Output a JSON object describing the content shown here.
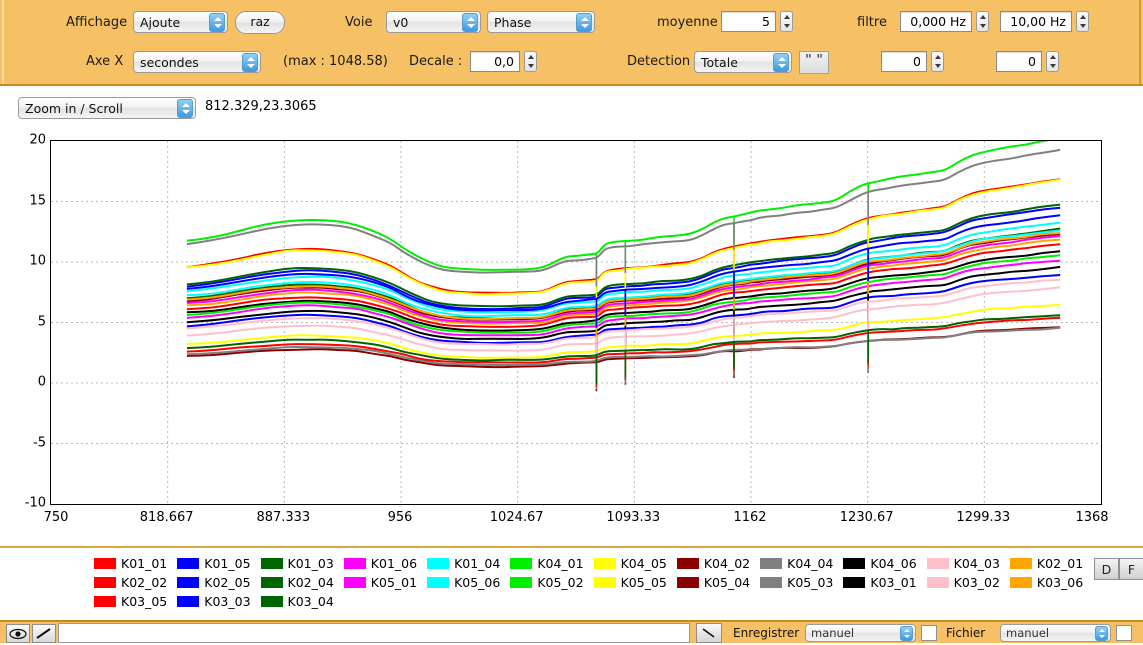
{
  "toolbar": {
    "affichage_label": "Affichage",
    "affichage_value": "Ajoute",
    "raz_label": "raz",
    "voie_label": "Voie",
    "voie_value": "v0",
    "phase_value": "Phase",
    "moyenne_label": "moyenne",
    "moyenne_value": "5",
    "filtre_label": "filtre",
    "filtre_low_value": "0,000 Hz",
    "filtre_high_value": "10,00 Hz",
    "axex_label": "Axe X",
    "axex_value": "secondes",
    "max_label": "(max : 1048.58)",
    "decale_label": "Decale :",
    "decale_value": "0,0",
    "detection_label": "Detection",
    "detection_value": "Totale",
    "quote_label": "\" \"",
    "extra_left_value": "0",
    "extra_right_value": "0"
  },
  "zoomrow": {
    "mode_value": "Zoom in / Scroll",
    "coords": "812.329,23.3065"
  },
  "legend_buttons": {
    "d_label": "D",
    "f_label": "F"
  },
  "bottom": {
    "eye_icon": "eye-icon",
    "pen_icon": "pen-icon",
    "path_value": "",
    "arrow_icon": "arrow-icon",
    "enregistrer_label": "Enregistrer",
    "enregistrer_value": "manuel",
    "fichier_label": "Fichier",
    "fichier_value": "manuel"
  },
  "chart_data": {
    "type": "line",
    "title": "",
    "xlabel": "",
    "ylabel": "",
    "xlim": [
      750,
      1368
    ],
    "ylim": [
      -10,
      20
    ],
    "xticks": [
      750,
      818.667,
      887.333,
      956,
      1024.67,
      1093.33,
      1162,
      1230.67,
      1299.33,
      1368
    ],
    "yticks": [
      20,
      15,
      10,
      5,
      0,
      -5,
      -10
    ],
    "xtick_labels": [
      "750",
      "818.667",
      "887.333",
      "956",
      "1024.67",
      "1093.33",
      "1162",
      "1230.67",
      "1299.33",
      "1368"
    ],
    "ytick_labels": [
      "20",
      "15",
      "10",
      "5",
      "0",
      "-5",
      "-10"
    ],
    "grid": true,
    "legend_position": "bottom",
    "data_x_start": 830,
    "data_x_end": 1344,
    "x": [
      830,
      845,
      860,
      875,
      890,
      900,
      910,
      920,
      930,
      940,
      950,
      958,
      966,
      974,
      982,
      992,
      1004,
      1016,
      1028,
      1040,
      1052,
      1060,
      1068,
      1072,
      1076,
      1082,
      1090,
      1098,
      1104,
      1110,
      1118,
      1126,
      1134,
      1140,
      1146,
      1152,
      1158,
      1162,
      1166,
      1172,
      1180,
      1188,
      1196,
      1204,
      1212,
      1220,
      1228,
      1234,
      1240,
      1246,
      1252,
      1260,
      1268,
      1276,
      1284,
      1292,
      1300,
      1308,
      1316,
      1324,
      1332,
      1344
    ],
    "shape_profile": [
      0.0,
      0.15,
      0.45,
      0.75,
      0.95,
      1.0,
      0.96,
      0.88,
      0.72,
      0.4,
      0.02,
      -0.45,
      -0.85,
      -1.15,
      -1.35,
      -1.45,
      -1.5,
      -1.5,
      -1.48,
      -1.45,
      -1.42,
      -1.4,
      -1.38,
      -1.36,
      -0.95,
      -0.9,
      -0.88,
      -0.87,
      -0.86,
      -0.85,
      -0.84,
      -0.83,
      -0.6,
      -0.35,
      -0.2,
      -0.15,
      -0.12,
      -0.1,
      -0.08,
      -0.05,
      -0.02,
      0.0,
      0.02,
      0.05,
      0.08,
      0.42,
      0.7,
      0.78,
      0.8,
      0.82,
      0.84,
      0.86,
      0.88,
      0.9,
      1.25,
      1.5,
      1.6,
      1.65,
      1.68,
      1.72,
      1.78,
      1.85
    ],
    "spikes": [
      {
        "x": 1071,
        "depth": 2.4
      },
      {
        "x": 1088,
        "depth": 2.2
      },
      {
        "x": 1152,
        "depth": 2.2
      },
      {
        "x": 1231,
        "depth": 2.6
      }
    ],
    "series": [
      {
        "name": "K01_01",
        "color": "#FF0000",
        "base": 9.6,
        "amp": 1.5,
        "end": 14.1
      },
      {
        "name": "K01_05",
        "color": "#0000FF",
        "base": 8.0,
        "amp": 1.3,
        "end": 12.1
      },
      {
        "name": "K01_03",
        "color": "#006400",
        "base": 8.2,
        "amp": 1.3,
        "end": 12.3
      },
      {
        "name": "K01_06",
        "color": "#FF00FF",
        "base": 5.4,
        "amp": 1.0,
        "end": 8.3
      },
      {
        "name": "K01_04",
        "color": "#00FFFF",
        "base": 7.6,
        "amp": 1.2,
        "end": 11.0
      },
      {
        "name": "K04_01",
        "color": "#00EE00",
        "base": 11.8,
        "amp": 1.7,
        "end": 17.1
      },
      {
        "name": "K04_05",
        "color": "#FFFF00",
        "base": 9.5,
        "amp": 1.5,
        "end": 14.0
      },
      {
        "name": "K04_02",
        "color": "#8B0000",
        "base": 6.8,
        "amp": 1.1,
        "end": 10.3
      },
      {
        "name": "K04_04",
        "color": "#808080",
        "base": 11.5,
        "amp": 1.65,
        "end": 16.2
      },
      {
        "name": "K04_06",
        "color": "#000000",
        "base": 5.8,
        "amp": 1.0,
        "end": 9.0
      },
      {
        "name": "K04_03",
        "color": "#FFC0CB",
        "base": 3.9,
        "amp": 0.85,
        "end": 6.3
      },
      {
        "name": "K02_01",
        "color": "#FFA500",
        "base": 6.4,
        "amp": 1.05,
        "end": 9.9
      },
      {
        "name": "K02_02",
        "color": "#FF0000",
        "base": 6.1,
        "amp": 1.0,
        "end": 9.6
      },
      {
        "name": "K02_05",
        "color": "#0000FF",
        "base": 4.7,
        "amp": 0.95,
        "end": 7.2
      },
      {
        "name": "K02_04",
        "color": "#006400",
        "base": 7.0,
        "amp": 1.15,
        "end": 10.6
      },
      {
        "name": "K05_01",
        "color": "#FF00FF",
        "base": 6.6,
        "amp": 1.1,
        "end": 10.1
      },
      {
        "name": "K05_06",
        "color": "#00FFFF",
        "base": 7.2,
        "amp": 1.15,
        "end": 10.5
      },
      {
        "name": "K05_02",
        "color": "#00EE00",
        "base": 5.6,
        "amp": 1.0,
        "end": 8.7
      },
      {
        "name": "K05_05",
        "color": "#FFFF00",
        "base": 3.2,
        "amp": 0.75,
        "end": 5.1
      },
      {
        "name": "K05_04",
        "color": "#8B0000",
        "base": 2.2,
        "amp": 0.6,
        "end": 3.5
      },
      {
        "name": "K05_03",
        "color": "#808080",
        "base": 2.4,
        "amp": 0.6,
        "end": 3.4
      },
      {
        "name": "K03_01",
        "color": "#000000",
        "base": 5.0,
        "amp": 0.95,
        "end": 7.8
      },
      {
        "name": "K03_02",
        "color": "#FFC0CB",
        "base": 4.5,
        "amp": 0.9,
        "end": 6.9
      },
      {
        "name": "K03_06",
        "color": "#FFA500",
        "base": 6.9,
        "amp": 1.1,
        "end": 10.4
      },
      {
        "name": "K03_05",
        "color": "#FF0000",
        "base": 2.6,
        "amp": 0.65,
        "end": 4.2
      },
      {
        "name": "K03_03",
        "color": "#0000FF",
        "base": 7.8,
        "amp": 1.25,
        "end": 11.5
      },
      {
        "name": "K03_04",
        "color": "#006400",
        "base": 2.9,
        "amp": 0.7,
        "end": 4.3
      }
    ],
    "legend_rows": [
      [
        {
          "name": "K01_01",
          "color": "#FF0000"
        },
        {
          "name": "K01_05",
          "color": "#0000FF"
        },
        {
          "name": "K01_03",
          "color": "#006400"
        },
        {
          "name": "K01_06",
          "color": "#FF00FF"
        },
        {
          "name": "K01_04",
          "color": "#00FFFF"
        },
        {
          "name": "K04_01",
          "color": "#00EE00"
        },
        {
          "name": "K04_05",
          "color": "#FFFF00"
        },
        {
          "name": "K04_02",
          "color": "#8B0000"
        },
        {
          "name": "K04_04",
          "color": "#808080"
        },
        {
          "name": "K04_06",
          "color": "#000000"
        },
        {
          "name": "K04_03",
          "color": "#FFC0CB"
        },
        {
          "name": "K02_01",
          "color": "#FFA500"
        }
      ],
      [
        {
          "name": "K02_02",
          "color": "#FF0000"
        },
        {
          "name": "K02_05",
          "color": "#0000FF"
        },
        {
          "name": "K02_04",
          "color": "#006400"
        },
        {
          "name": "K05_01",
          "color": "#FF00FF"
        },
        {
          "name": "K05_06",
          "color": "#00FFFF"
        },
        {
          "name": "K05_02",
          "color": "#00EE00"
        },
        {
          "name": "K05_05",
          "color": "#FFFF00"
        },
        {
          "name": "K05_04",
          "color": "#8B0000"
        },
        {
          "name": "K05_03",
          "color": "#808080"
        },
        {
          "name": "K03_01",
          "color": "#000000"
        },
        {
          "name": "K03_02",
          "color": "#FFC0CB"
        },
        {
          "name": "K03_06",
          "color": "#FFA500"
        }
      ],
      [
        {
          "name": "K03_05",
          "color": "#FF0000"
        },
        {
          "name": "K03_03",
          "color": "#0000FF"
        },
        {
          "name": "K03_04",
          "color": "#006400"
        }
      ]
    ]
  }
}
